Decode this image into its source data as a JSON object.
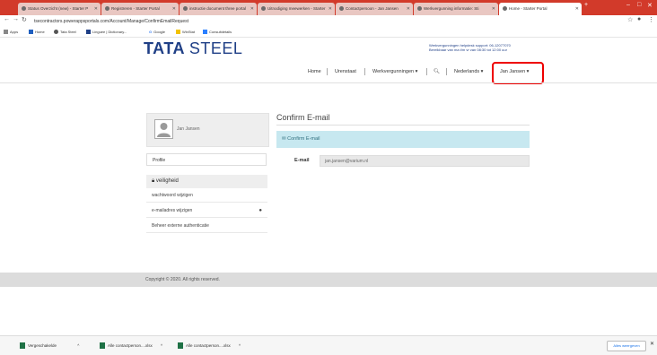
{
  "browser": {
    "tabs": [
      {
        "title": "Status Overzicht (new) - Starter P",
        "active": false
      },
      {
        "title": "Registreren - Starter Portal",
        "active": false
      },
      {
        "title": "instructie document three portal",
        "active": false
      },
      {
        "title": "Uitnodiging meewerken - Starter",
        "active": false
      },
      {
        "title": "Contactpersoon - Jan Jansen",
        "active": false
      },
      {
        "title": "Werkvergunning informatie: Sti",
        "active": false
      },
      {
        "title": "Home - Starter Portal",
        "active": true
      }
    ],
    "new_tab": "+",
    "url": "tsecontractors.powerappsportals.com/Account/Manage/ConfirmEmailRequest",
    "bookmarks": [
      "Apps",
      "Home",
      "Tata Steel",
      "Linguee | Dictionary...",
      "Google",
      "WinStat",
      "Consultdetails"
    ]
  },
  "header": {
    "logo_text": "TATA",
    "logo_text2": "STEEL",
    "helpdesk_line1": "Werkvergunningen helpdesk support: 06-12077070",
    "helpdesk_line2": "Bereikbaar van ma t/m vr van 08:30 tot 12:00 uur",
    "nav": {
      "home": "Home",
      "urenstaat": "Urenstaat",
      "werkvergunningen": "Werkvergunningen ▾",
      "search_icon": "search-icon",
      "language": "Nederlands ▾",
      "user": "Jan Jansen ▾"
    }
  },
  "sidebar": {
    "user_name": "Jan Jansen",
    "profile_link": "Profile",
    "security_heading": "veiligheid",
    "menu": [
      {
        "label": "wachtwoord wijzigen"
      },
      {
        "label": "e-mailadres wijzigen"
      },
      {
        "label": "Beheer externe authenticatie"
      }
    ]
  },
  "main": {
    "title": "Confirm E-mail",
    "alert_text": "Confirm E-mail",
    "email_label": "E-mail",
    "email_value": "jan.jansen@varium.nl"
  },
  "footer": {
    "copyright": "Copyright © 2020. All rights reserved."
  },
  "downloads": {
    "items": [
      "Vergeschakelde",
      "Alle contactperson....xlsx",
      "Alle contactperson....xlsx"
    ],
    "show_all": "Alles weergeven",
    "close": "✕"
  },
  "colors": {
    "brand_blue": "#1f3f86",
    "tabstrip_red": "#d23a2a",
    "alert_bg": "#c7e8f0",
    "highlight_red": "#ee0000"
  }
}
